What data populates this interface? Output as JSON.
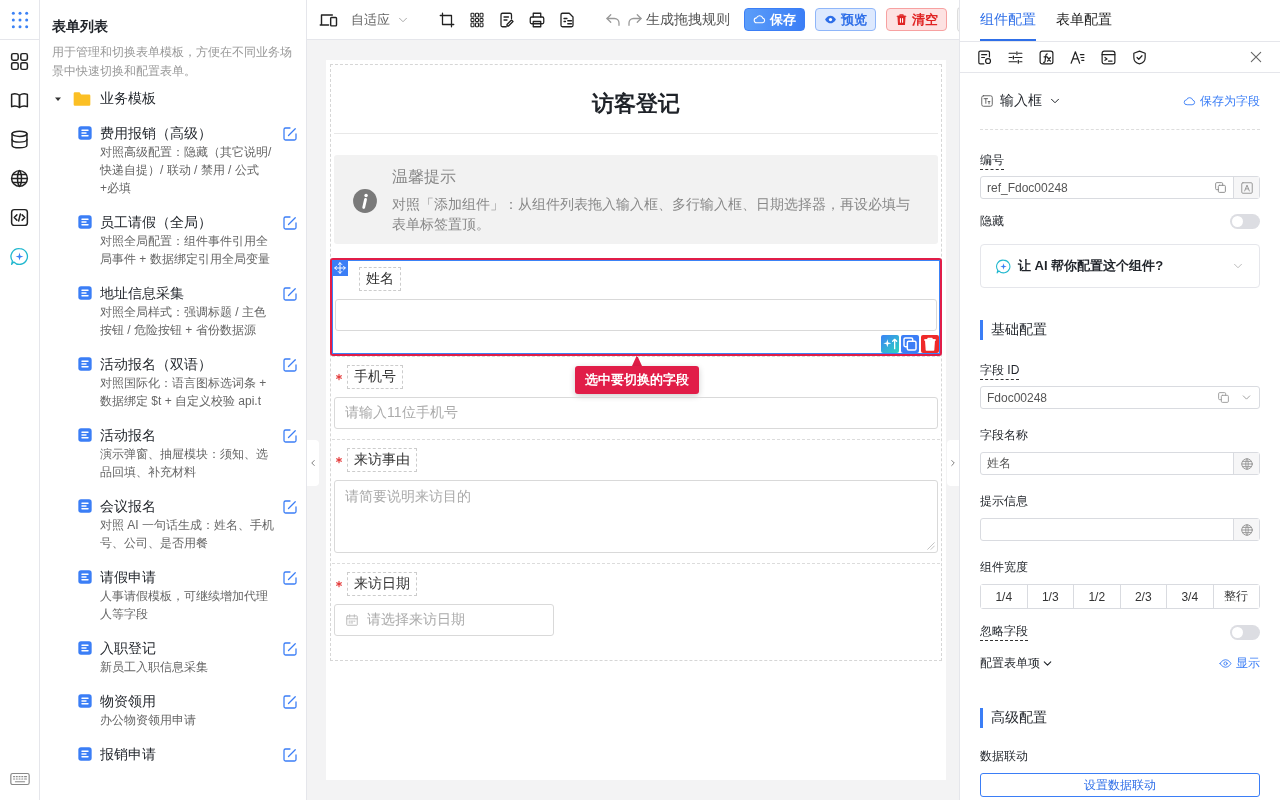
{
  "form_list": {
    "title": "表单列表",
    "description": "用于管理和切换表单模板，方便在不同业务场景中快速切换和配置表单。",
    "folder": {
      "label": "业务模板",
      "expanded": true,
      "children": [
        {
          "title": "费用报销（高级）",
          "description": "对照高级配置：隐藏（其它说明/快递自提）/ 联动 / 禁用 / 公式+必填"
        },
        {
          "title": "员工请假（全局）",
          "description": "对照全局配置：组件事件引用全局事件 + 数据绑定引用全局变量"
        },
        {
          "title": "地址信息采集",
          "description": "对照全局样式：强调标题 / 主色按钮 / 危险按钮 + 省份数据源"
        },
        {
          "title": "活动报名（双语）",
          "description": "对照国际化：语言图标选词条 + 数据绑定 $t + 自定义校验 api.t"
        },
        {
          "title": "活动报名",
          "description": "演示弹窗、抽屉模块：须知、选品回填、补充材料"
        },
        {
          "title": "会议报名",
          "description": "对照 AI 一句话生成：姓名、手机号、公司、是否用餐"
        },
        {
          "title": "请假申请",
          "description": "人事请假模板，可继续增加代理人等字段"
        },
        {
          "title": "入职登记",
          "description": "新员工入职信息采集"
        },
        {
          "title": "物资领用",
          "description": "办公物资领用申请"
        },
        {
          "title": "报销申请"
        }
      ]
    }
  },
  "toolbar": {
    "device_mode": "自适应",
    "generate_rules": "生成拖拽规则",
    "buttons": [
      {
        "label": "保存",
        "kind": "primary"
      },
      {
        "label": "预览",
        "kind": "secondary"
      },
      {
        "label": "清空",
        "kind": "danger"
      }
    ]
  },
  "form": {
    "title": "访客登记",
    "notice": {
      "title": "温馨提示",
      "text": "对照「添加组件」：从组件列表拖入输入框、多行输入框、日期选择器，再设必填与表单标签置顶。"
    },
    "fields": [
      {
        "label": "姓名",
        "kind": "input",
        "required": false,
        "selected": true
      },
      {
        "label": "手机号",
        "kind": "input",
        "required": true,
        "selected": false,
        "placeholder": "请输入11位手机号"
      },
      {
        "label": "来访事由",
        "kind": "textarea",
        "required": true,
        "selected": false,
        "placeholder": "请简要说明来访目的"
      },
      {
        "label": "来访日期",
        "kind": "date",
        "required": true,
        "selected": false,
        "placeholder": "请选择来访日期"
      }
    ],
    "tooltip": "选中要切换的字段"
  },
  "config": {
    "tabs": [
      {
        "label": "组件配置",
        "selected": true
      },
      {
        "label": "表单配置",
        "selected": false
      }
    ],
    "component_type": "输入框",
    "save_as_field": "保存为字段",
    "number": {
      "label": "编号",
      "value": "ref_Fdoc00248"
    },
    "hidden": {
      "label": "隐藏",
      "on": false
    },
    "ai_assist": "让 AI 帮你配置这个组件?",
    "basic": {
      "title": "基础配置",
      "field_id": {
        "label": "字段 ID",
        "value": "Fdoc00248"
      },
      "field_name": {
        "label": "字段名称",
        "value": "姓名"
      },
      "hint": {
        "label": "提示信息"
      },
      "width": {
        "label": "组件宽度",
        "options": [
          "1/4",
          "1/3",
          "1/2",
          "2/3",
          "3/4",
          "整行"
        ]
      },
      "ignore": {
        "label": "忽略字段",
        "on": false
      },
      "form_items": {
        "label": "配置表单项",
        "action": "显示"
      }
    },
    "advanced": {
      "title": "高级配置",
      "linkage_label": "数据联动",
      "linkage_button": "设置数据联动"
    }
  }
}
